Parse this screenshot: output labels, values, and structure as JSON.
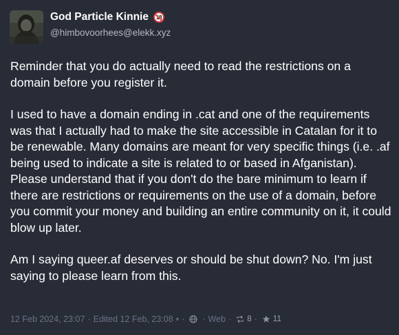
{
  "author": {
    "display_name": "God Particle Kinnie",
    "age_badge": "18",
    "handle": "@himbovoorhees@elekk.xyz"
  },
  "post": {
    "paragraphs": [
      "Reminder that you do actually need to read the restrictions on a domain before you register it.",
      "I used to have a domain ending in .cat and one of the requirements was that I actually had to make the site accessible in Catalan for it to be renewable. Many domains are meant for very specific things (i.e. .af being used to indicate a site is related to or based in Afganistan). Please understand that if you don't do the bare minimum to learn if there are restrictions or requirements on the use of a domain, before you commit your money and building an entire community on it, it could blow up later.",
      "Am I saying queer.af deserves or should be shut down? No. I'm just saying to please learn from this."
    ]
  },
  "meta": {
    "timestamp": "12 Feb 2024, 23:07",
    "separator": "·",
    "edited": "Edited 12 Feb, 23:08",
    "caret": "▾",
    "visibility_icon": "globe-icon",
    "app": "Web",
    "boost_icon": "boost-icon",
    "boosts": "8",
    "favourite_icon": "star-icon",
    "favourites": "11"
  },
  "colors": {
    "background": "#282c37",
    "text": "#ffffff",
    "muted": "#6b7185",
    "handle": "#b4b8c8",
    "badge_red": "#d83a3a"
  }
}
